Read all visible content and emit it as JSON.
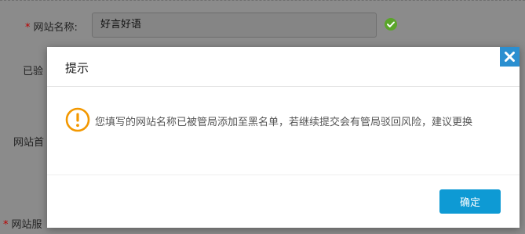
{
  "form": {
    "required_mark": "*",
    "site_name_label": "网站名称:",
    "site_name_value": "好言好语",
    "verified_label_partial": "已验",
    "homepage_label_partial": "网站首",
    "service_label_partial": "网站服"
  },
  "dialog": {
    "title": "提示",
    "message": "您填写的网站名称已被管局添加至黑名单，若继续提交会有管局驳回风险，建议更换",
    "confirm_label": "确定",
    "close_icon": "close-icon",
    "warning_icon": "exclamation-circle-icon"
  },
  "colors": {
    "accent": "#0e9ad4",
    "warning": "#f39800",
    "success": "#5aa52a",
    "close_bg": "#2b8fd0"
  }
}
